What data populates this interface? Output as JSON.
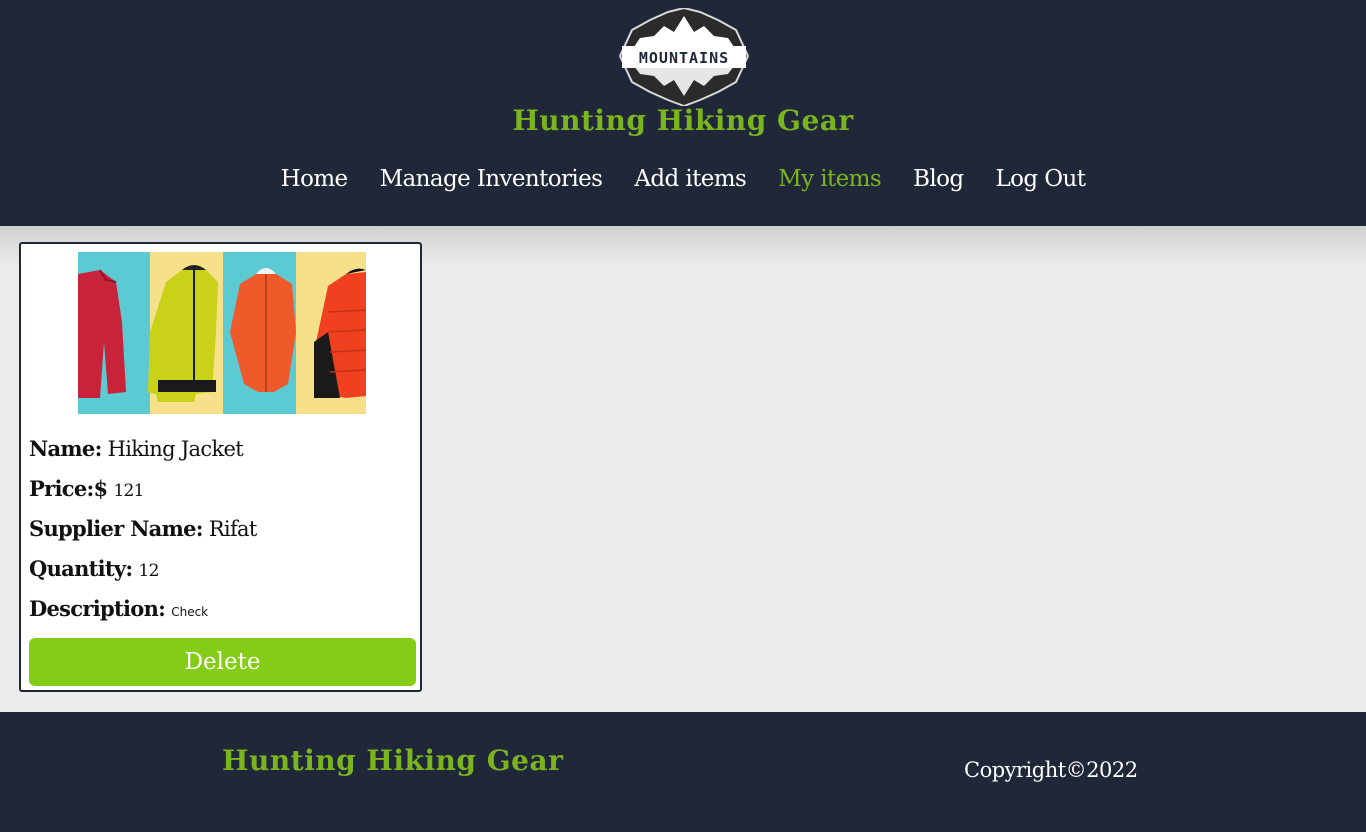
{
  "header": {
    "logo_text": "MOUNTAINS",
    "site_title": "Hunting Hiking Gear"
  },
  "nav": {
    "items": [
      {
        "label": "Home",
        "active": false
      },
      {
        "label": "Manage Inventories",
        "active": false
      },
      {
        "label": "Add items",
        "active": false
      },
      {
        "label": "My items",
        "active": true
      },
      {
        "label": "Blog",
        "active": false
      },
      {
        "label": "Log Out",
        "active": false
      }
    ]
  },
  "item": {
    "image_icon": "jackets-image",
    "name_label": "Name:",
    "name": "Hiking Jacket",
    "price_label": "Price:$",
    "price": "121",
    "supplier_label": "Supplier Name:",
    "supplier": "Rifat",
    "quantity_label": "Quantity:",
    "quantity": "12",
    "description_label": "Description:",
    "description": "Check",
    "delete_label": "Delete"
  },
  "footer": {
    "title": "Hunting Hiking Gear",
    "copyright": "Copyright©2022"
  },
  "colors": {
    "header_bg": "#1f2739",
    "accent_green": "#7ab51d",
    "button_green": "#84cc16",
    "page_bg": "#ececec"
  }
}
